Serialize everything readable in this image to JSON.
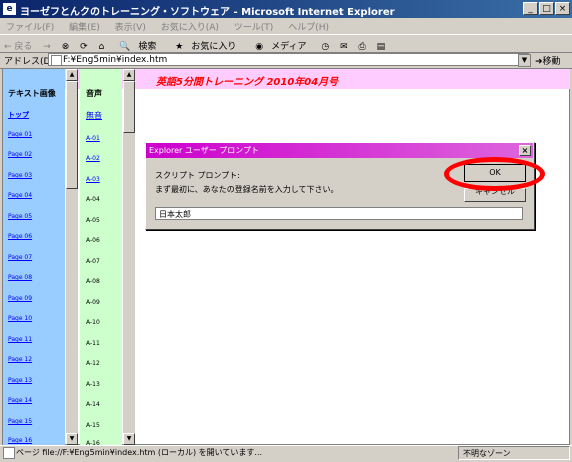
{
  "window": {
    "title": "ヨーゼフとんクのトレーニング・ソフトウェア - Microsoft Internet Explorer"
  },
  "window_controls": {
    "min": "_",
    "max": "□",
    "close": "×"
  },
  "menubar": [
    "ファイル(F)",
    "編集(E)",
    "表示(V)",
    "お気に入り(A)",
    "ツール(T)",
    "ヘルプ(H)"
  ],
  "toolbar": {
    "back": "← 戻る",
    "forward": "→",
    "search": "検索",
    "favorites": "お気に入り",
    "media": "メディア"
  },
  "address": {
    "label": "アドレス(D)",
    "value": "F:¥Eng5min¥index.htm",
    "go": "移動"
  },
  "header": {
    "title": "英語5分間トレーニング  2010年04月号"
  },
  "left_frame": {
    "heading": "テキスト画像",
    "top_link": "トップ",
    "items": [
      "Page 01",
      "Page 02",
      "Page 03",
      "Page 04",
      "Page 05",
      "Page 06",
      "Page 07",
      "Page 08",
      "Page 09",
      "Page 10",
      "Page 11",
      "Page 12",
      "Page 13",
      "Page 14",
      "Page 15",
      "Page 16"
    ]
  },
  "mid_frame": {
    "heading": "音声",
    "top_link": "無音",
    "items": [
      "A-01",
      "A-02",
      "A-03",
      "A-04",
      "A-05",
      "A-06",
      "A-07",
      "A-08",
      "A-09",
      "A-10",
      "A-11",
      "A-12",
      "A-13",
      "A-14",
      "A-15",
      "A-16"
    ]
  },
  "dialog": {
    "title": "Explorer ユーザー プロンプト",
    "close": "×",
    "label": "スクリプト プロンプト:",
    "message": "まず最初に、あなたの登録名前を入力して下さい。",
    "ok": "OK",
    "cancel": "キャンセル",
    "input_value": "日本太郎"
  },
  "status": {
    "text": "ページ file://F:¥Eng5min¥index.htm (ローカル) を開いています...",
    "zone": "不明なゾーン"
  }
}
